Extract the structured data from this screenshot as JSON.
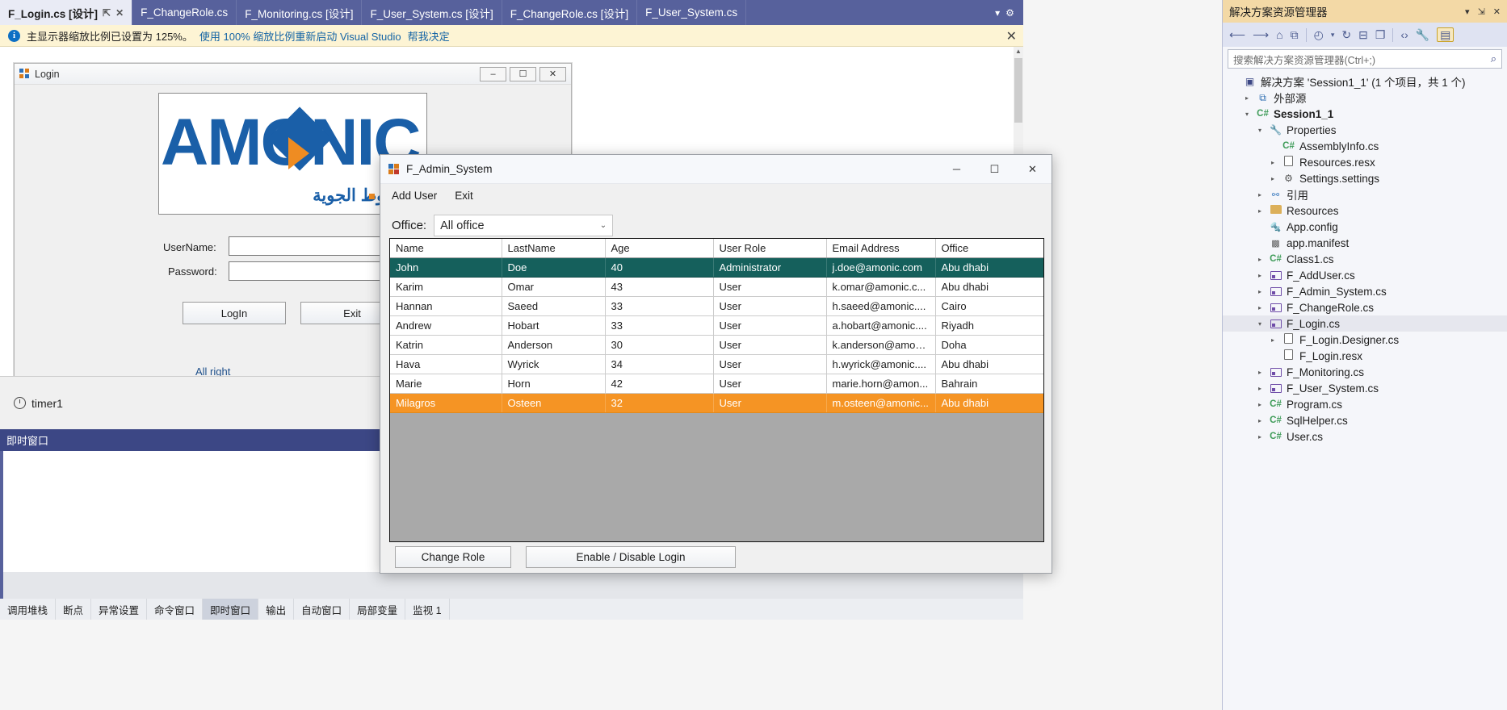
{
  "ide": {
    "tabs": [
      {
        "label": "F_Login.cs [设计]",
        "active": true
      },
      {
        "label": "F_ChangeRole.cs",
        "active": false
      },
      {
        "label": "F_Monitoring.cs [设计]",
        "active": false
      },
      {
        "label": "F_User_System.cs [设计]",
        "active": false
      },
      {
        "label": "F_ChangeRole.cs [设计]",
        "active": false
      },
      {
        "label": "F_User_System.cs",
        "active": false
      }
    ],
    "tab_pin_icon": "pin-icon",
    "tab_close_icon": "close-icon",
    "tabstrip_overflow_icon": "chevron-down-icon",
    "tabstrip_settings_icon": "gear-icon"
  },
  "infobar": {
    "icon": "info-icon",
    "message": "主显示器缩放比例已设置为 125%。",
    "link_restart": "使用 100% 缩放比例重新启动 Visual Studio",
    "link_help": "帮我决定",
    "close_icon": "close-icon"
  },
  "designer": {
    "login_form": {
      "title": "Login",
      "icon": "form-icon",
      "minimize_label": "–",
      "maximize_label": "☐",
      "close_label": "✕",
      "logo_text": "AMONIC",
      "logo_arabic": "الخطوط الجوية",
      "username_label": "UserName:",
      "password_label": "Password:",
      "login_button": "LogIn",
      "exit_button": "Exit",
      "status_text": "All right"
    },
    "tray": {
      "component_label": "timer1",
      "component_icon": "timer-icon"
    }
  },
  "immediate_window": {
    "title": "即时窗口",
    "bottom_tabs": [
      {
        "label": "调用堆栈",
        "selected": false
      },
      {
        "label": "断点",
        "selected": false
      },
      {
        "label": "异常设置",
        "selected": false
      },
      {
        "label": "命令窗口",
        "selected": false
      },
      {
        "label": "即时窗口",
        "selected": true
      },
      {
        "label": "输出",
        "selected": false
      },
      {
        "label": "自动窗口",
        "selected": false
      },
      {
        "label": "局部变量",
        "selected": false
      },
      {
        "label": "监视 1",
        "selected": false
      }
    ]
  },
  "solution_explorer": {
    "title": "解决方案资源管理器",
    "title_dropdown_icon": "chevron-down-icon",
    "title_pin_icon": "pin-icon",
    "title_close_icon": "close-icon",
    "toolbar": [
      {
        "name": "back-icon",
        "glyph": "←"
      },
      {
        "name": "forward-icon",
        "glyph": "→"
      },
      {
        "name": "home-icon",
        "glyph": "⌂"
      },
      {
        "name": "sync-with-active-document-icon",
        "glyph": "⧉"
      },
      {
        "name": "pending-changes-icon",
        "glyph": "◴"
      },
      {
        "name": "pending-changes-dropdown-icon",
        "glyph": "▾"
      },
      {
        "name": "refresh-icon",
        "glyph": "↻"
      },
      {
        "name": "collapse-all-icon",
        "glyph": "⊟"
      },
      {
        "name": "show-all-files-icon",
        "glyph": "❐"
      },
      {
        "name": "view-code-icon",
        "glyph": "‹›"
      },
      {
        "name": "properties-icon",
        "glyph": "ὒ7"
      },
      {
        "name": "preview-selected-items-icon",
        "glyph": "▤"
      }
    ],
    "search_placeholder": "搜索解决方案资源管理器(Ctrl+;)",
    "search_value": "",
    "search_icon": "magnifier-icon",
    "tree": [
      {
        "depth": 0,
        "twisty": "",
        "icon": "solution-icon",
        "label": "解决方案 'Session1_1' (1 个项目，共 1 个)",
        "bold": false,
        "selected": false
      },
      {
        "depth": 1,
        "twisty": "▸",
        "icon": "external-sources-icon",
        "label": "外部源",
        "bold": false,
        "selected": false
      },
      {
        "depth": 1,
        "twisty": "▾",
        "icon": "csharp-project-icon",
        "label": "Session1_1",
        "bold": true,
        "selected": false
      },
      {
        "depth": 2,
        "twisty": "▾",
        "icon": "wrench-icon",
        "label": "Properties",
        "bold": false,
        "selected": false
      },
      {
        "depth": 3,
        "twisty": "",
        "icon": "csharp-file-icon",
        "label": "AssemblyInfo.cs",
        "bold": false,
        "selected": false
      },
      {
        "depth": 3,
        "twisty": "▸",
        "icon": "resx-icon",
        "label": "Resources.resx",
        "bold": false,
        "selected": false
      },
      {
        "depth": 3,
        "twisty": "▸",
        "icon": "settings-icon",
        "label": "Settings.settings",
        "bold": false,
        "selected": false
      },
      {
        "depth": 2,
        "twisty": "▸",
        "icon": "references-icon",
        "label": "引用",
        "bold": false,
        "selected": false
      },
      {
        "depth": 2,
        "twisty": "▸",
        "icon": "folder-icon",
        "label": "Resources",
        "bold": false,
        "selected": false
      },
      {
        "depth": 2,
        "twisty": "",
        "icon": "config-icon",
        "label": "App.config",
        "bold": false,
        "selected": false
      },
      {
        "depth": 2,
        "twisty": "",
        "icon": "manifest-icon",
        "label": "app.manifest",
        "bold": false,
        "selected": false
      },
      {
        "depth": 2,
        "twisty": "▸",
        "icon": "csharp-file-icon",
        "label": "Class1.cs",
        "bold": false,
        "selected": false
      },
      {
        "depth": 2,
        "twisty": "▸",
        "icon": "winform-icon",
        "label": "F_AddUser.cs",
        "bold": false,
        "selected": false
      },
      {
        "depth": 2,
        "twisty": "▸",
        "icon": "winform-icon",
        "label": "F_Admin_System.cs",
        "bold": false,
        "selected": false
      },
      {
        "depth": 2,
        "twisty": "▸",
        "icon": "winform-icon",
        "label": "F_ChangeRole.cs",
        "bold": false,
        "selected": false
      },
      {
        "depth": 2,
        "twisty": "▾",
        "icon": "winform-icon",
        "label": "F_Login.cs",
        "bold": false,
        "selected": true
      },
      {
        "depth": 3,
        "twisty": "▸",
        "icon": "designer-file-icon",
        "label": "F_Login.Designer.cs",
        "bold": false,
        "selected": false
      },
      {
        "depth": 3,
        "twisty": "",
        "icon": "resx-file-icon",
        "label": "F_Login.resx",
        "bold": false,
        "selected": false
      },
      {
        "depth": 2,
        "twisty": "▸",
        "icon": "winform-icon",
        "label": "F_Monitoring.cs",
        "bold": false,
        "selected": false
      },
      {
        "depth": 2,
        "twisty": "▸",
        "icon": "winform-icon",
        "label": "F_User_System.cs",
        "bold": false,
        "selected": false
      },
      {
        "depth": 2,
        "twisty": "▸",
        "icon": "csharp-file-icon",
        "label": "Program.cs",
        "bold": false,
        "selected": false
      },
      {
        "depth": 2,
        "twisty": "▸",
        "icon": "csharp-file-icon",
        "label": "SqlHelper.cs",
        "bold": false,
        "selected": false
      },
      {
        "depth": 2,
        "twisty": "▸",
        "icon": "csharp-file-icon",
        "label": "User.cs",
        "bold": false,
        "selected": false
      }
    ]
  },
  "admin_dialog": {
    "title": "F_Admin_System",
    "icon": "form-icon",
    "minimize_label": "─",
    "maximize_label": "☐",
    "close_label": "✕",
    "menu": [
      {
        "label": "Add User"
      },
      {
        "label": "Exit"
      }
    ],
    "office_label": "Office:",
    "office_value": "All office",
    "office_dropdown_icon": "chevron-down-icon",
    "columns": [
      "Name",
      "LastName",
      "Age",
      "User Role",
      "Email Address",
      "Office"
    ],
    "rows": [
      {
        "cells": [
          "John",
          "Doe",
          "40",
          "Administrator",
          "j.doe@amonic.com",
          "Abu dhabi"
        ],
        "highlight": "green"
      },
      {
        "cells": [
          "Karim",
          "Omar",
          "43",
          "User",
          "k.omar@amonic.c...",
          "Abu dhabi"
        ],
        "highlight": ""
      },
      {
        "cells": [
          "Hannan",
          "Saeed",
          "33",
          "User",
          "h.saeed@amonic....",
          "Cairo"
        ],
        "highlight": ""
      },
      {
        "cells": [
          "Andrew",
          "Hobart",
          "33",
          "User",
          "a.hobart@amonic....",
          "Riyadh"
        ],
        "highlight": ""
      },
      {
        "cells": [
          "Katrin",
          "Anderson",
          "30",
          "User",
          "k.anderson@amon...",
          "Doha"
        ],
        "highlight": ""
      },
      {
        "cells": [
          "Hava",
          "Wyrick",
          "34",
          "User",
          "h.wyrick@amonic....",
          "Abu dhabi"
        ],
        "highlight": ""
      },
      {
        "cells": [
          "Marie",
          "Horn",
          "42",
          "User",
          "marie.horn@amon...",
          "Bahrain"
        ],
        "highlight": ""
      },
      {
        "cells": [
          "Milagros",
          "Osteen",
          "32",
          "User",
          "m.osteen@amonic...",
          "Abu dhabi"
        ],
        "highlight": "orange"
      }
    ],
    "change_role_button": "Change Role",
    "enable_disable_button": "Enable / Disable Login"
  },
  "colors": {
    "vs_tab_bar": "#57619c",
    "infobar_bg": "#fdf4d4",
    "se_title_bg": "#f3d9a6",
    "grid_selected_green": "#15605c",
    "grid_selected_orange": "#f59424",
    "logo_blue": "#1a5fa8",
    "logo_orange": "#ef8c22"
  }
}
